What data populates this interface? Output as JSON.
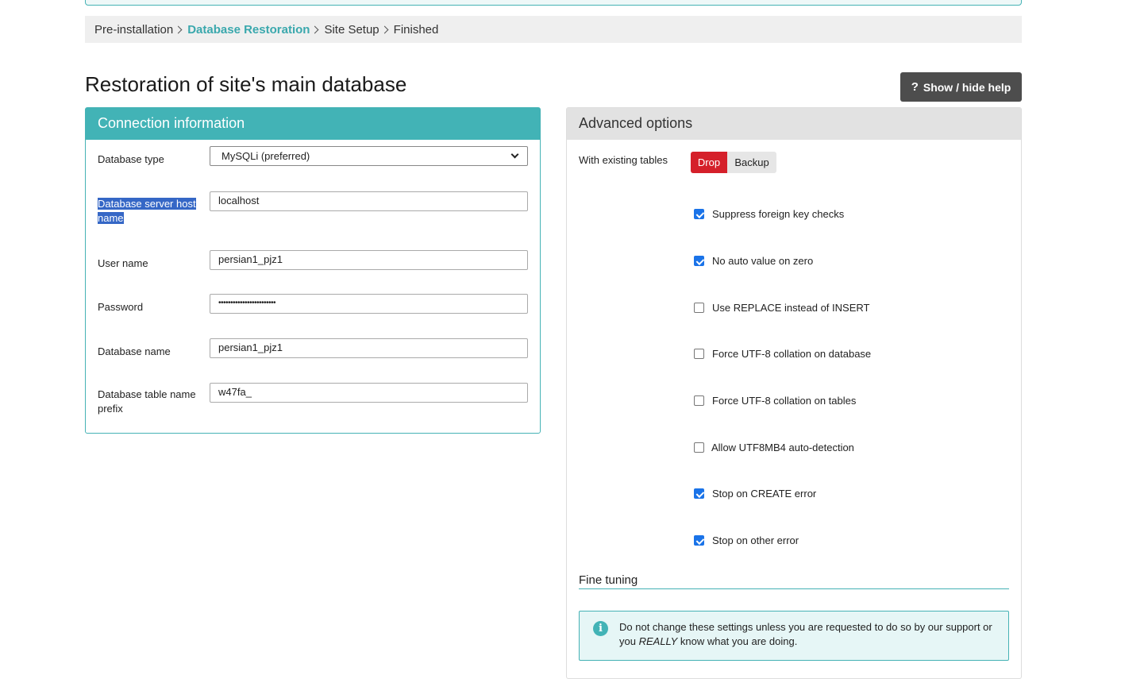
{
  "breadcrumb": {
    "steps": [
      "Pre-installation",
      "Database Restoration",
      "Site Setup",
      "Finished"
    ],
    "active_index": 1
  },
  "page_title": "Restoration of site's main database",
  "help_button": {
    "icon": "?",
    "label": "Show / hide help"
  },
  "connection": {
    "title": "Connection information",
    "db_type_label": "Database type",
    "db_type_value": "MySQLi (preferred)",
    "host_label": "Database server host name",
    "host_value": "localhost",
    "user_label": "User name",
    "user_value": "persian1_pjz1",
    "password_label": "Password",
    "password_value": "••••••••••••••••••••••••",
    "dbname_label": "Database name",
    "dbname_value": "persian1_pjz1",
    "prefix_label": "Database table name prefix",
    "prefix_value": "w47fa_"
  },
  "advanced": {
    "title": "Advanced options",
    "existing_label": "With existing tables",
    "drop_label": "Drop",
    "backup_label": "Backup",
    "options": [
      {
        "label": "Suppress foreign key checks",
        "checked": true
      },
      {
        "label": "No auto value on zero",
        "checked": true
      },
      {
        "label": "Use REPLACE instead of INSERT",
        "checked": false
      },
      {
        "label": "Force UTF-8 collation on database",
        "checked": false
      },
      {
        "label": "Force UTF-8 collation on tables",
        "checked": false
      },
      {
        "label": "Allow UTF8MB4 auto-detection",
        "checked": false
      },
      {
        "label": "Stop on CREATE error",
        "checked": true
      },
      {
        "label": "Stop on other error",
        "checked": true
      }
    ],
    "fine_tuning_title": "Fine tuning",
    "info_icon": "i",
    "info_text_1": "Do not change these settings unless you are requested to do so by our support or you",
    "info_text_em": "REALLY",
    "info_text_2": " know what you are doing."
  },
  "colors": {
    "accent": "#42b3b6",
    "danger": "#d5202a",
    "dark_button": "#4d4d4d"
  }
}
